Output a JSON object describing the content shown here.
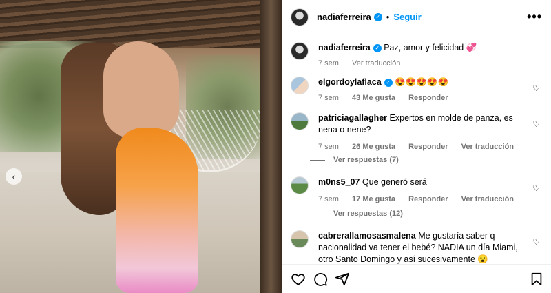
{
  "post": {
    "username": "nadiaferreira",
    "follow_label": "Seguir",
    "separator": "•",
    "more_label": "•••",
    "caption": {
      "username": "nadiaferreira",
      "text": "Paz, amor y felicidad 💞",
      "time": "7 sem",
      "translate": "Ver traducción"
    }
  },
  "comments": [
    {
      "username": "elgordoylaflaca",
      "text": "😍😍😍😍😍",
      "time": "7 sem",
      "likes": "43 Me gusta",
      "reply": "Responder"
    },
    {
      "username": "patriciagallagher",
      "text": "Expertos en molde de panza, es nena o nene?",
      "time": "7 sem",
      "likes": "26 Me gusta",
      "reply": "Responder",
      "translate": "Ver traducción",
      "replies": "Ver respuestas (7)"
    },
    {
      "username": "m0ns5_07",
      "text": "Que generó será",
      "time": "7 sem",
      "likes": "17 Me gusta",
      "reply": "Responder",
      "translate": "Ver traducción",
      "replies": "Ver respuestas (12)"
    },
    {
      "username": "cabrerallamosasmalena",
      "text": "Me gustaría saber q nacionalidad va tener el bebé? NADIA un día Miami, otro Santo Domingo y así sucesivamente 😮"
    }
  ],
  "icons": {
    "heart": "heart-icon",
    "comment": "comment-icon",
    "share": "share-icon",
    "save": "bookmark-icon",
    "verified": "verified-badge-icon"
  },
  "colors": {
    "accent": "#0095f6",
    "muted": "#737373"
  }
}
